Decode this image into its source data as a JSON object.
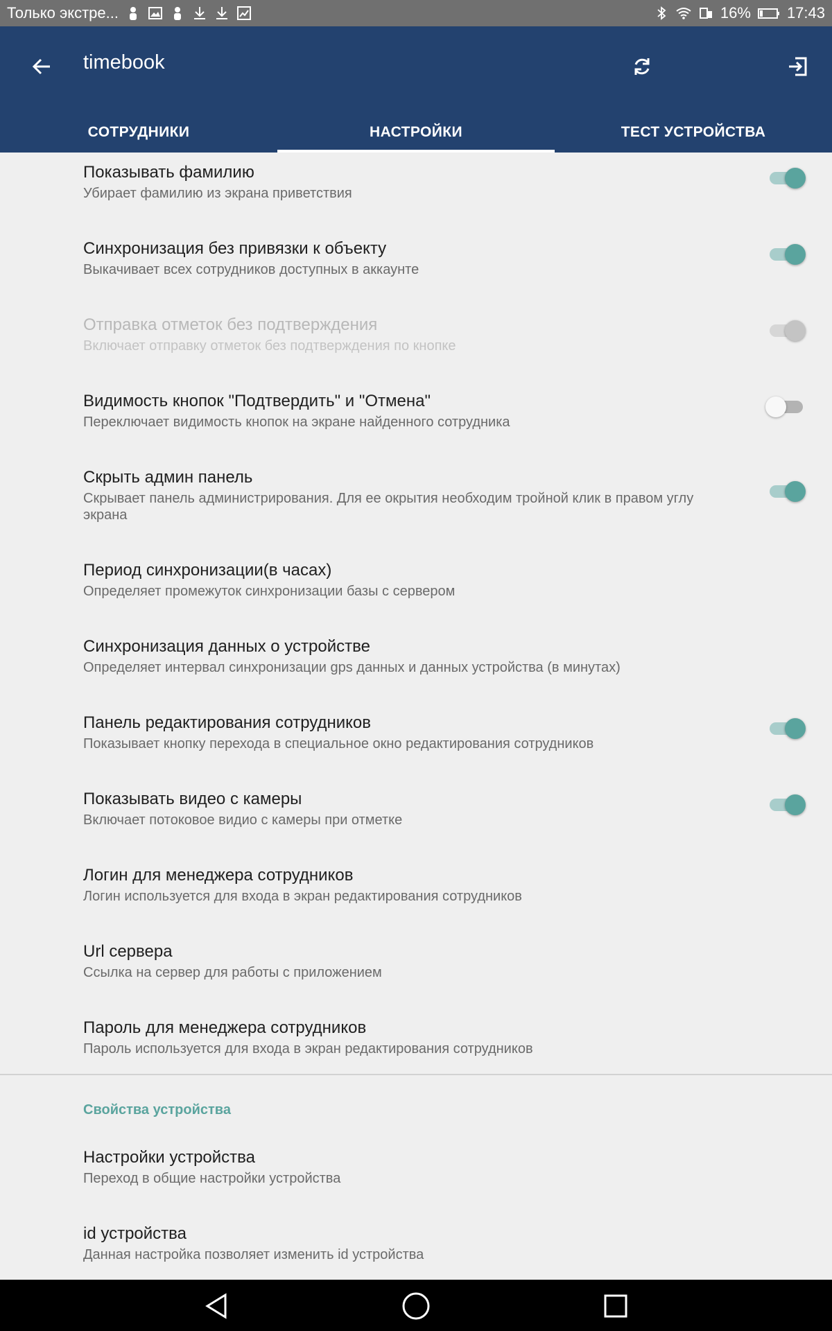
{
  "status": {
    "notification_text": "Только экстре...",
    "battery": "16%",
    "time": "17:43"
  },
  "app": {
    "title": "timebook"
  },
  "tabs": [
    {
      "label": "СОТРУДНИКИ",
      "active": false
    },
    {
      "label": "НАСТРОЙКИ",
      "active": true
    },
    {
      "label": "ТЕСТ УСТРОЙСТВА",
      "active": false
    }
  ],
  "settings": [
    {
      "title": "Показывать фамилию",
      "summary": "Убирает фамилию из экрана приветствия",
      "switch": "on"
    },
    {
      "title": "Синхронизация без привязки к объекту",
      "summary": "Выкачивает всех сотрудников доступных в аккаунте",
      "switch": "on"
    },
    {
      "title": "Отправка отметок без подтверждения",
      "summary": "Включает отправку отметок без подтверждения по кнопке",
      "switch": "disabled"
    },
    {
      "title": "Видимость кнопок \"Подтвердить\" и \"Отмена\"",
      "summary": "Переключает видимость кнопок на экране найденного сотрудника",
      "switch": "off"
    },
    {
      "title": "Скрыть админ панель",
      "summary": "Скрывает панель администрирования. Для ее окрытия необходим тройной клик в правом углу экрана",
      "switch": "on"
    },
    {
      "title": "Период синхронизации(в часах)",
      "summary": "Определяет промежуток синхронизации базы с сервером",
      "switch": "none"
    },
    {
      "title": "Синхронизация данных о устройстве",
      "summary": "Определяет интервал синхронизации gps данных и данных устройства (в минутах)",
      "switch": "none"
    },
    {
      "title": "Панель редактирования сотрудников",
      "summary": "Показывает кнопку перехода в специальное окно редактирования сотрудников",
      "switch": "on"
    },
    {
      "title": "Показывать видео с камеры",
      "summary": "Включает потоковое видио с камеры при отметке",
      "switch": "on"
    },
    {
      "title": "Логин для менеджера сотрудников",
      "summary": "Логин используется для входа в экран редактирования сотрудников",
      "switch": "none"
    },
    {
      "title": "Url сервера",
      "summary": "Ссылка на сервер для работы с приложением",
      "switch": "none"
    },
    {
      "title": "Пароль для менеджера сотрудников",
      "summary": "Пароль используется для входа в экран редактирования сотрудников",
      "switch": "none"
    }
  ],
  "device_section": {
    "header": "Свойства устройства",
    "items": [
      {
        "title": "Настройки устройства",
        "summary": "Переход в общие настройки устройства"
      },
      {
        "title": "id устройства",
        "summary": "Данная настройка позволяет изменить id устройства"
      }
    ]
  },
  "colors": {
    "app_bar": "#23426f",
    "accent": "#5aa49e",
    "status_bar": "#707070"
  }
}
